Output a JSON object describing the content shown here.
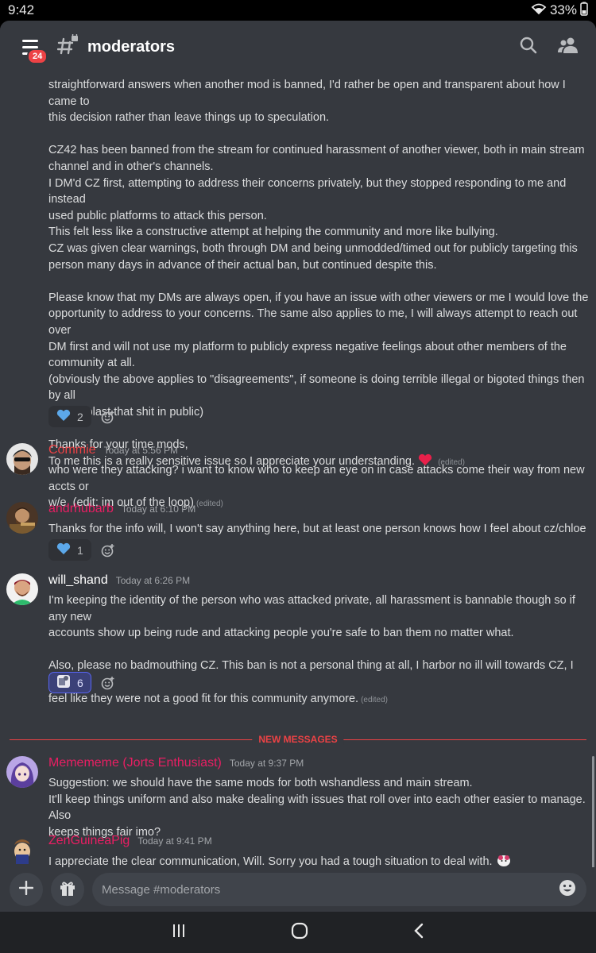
{
  "status": {
    "time": "9:42",
    "battery": "33%"
  },
  "header": {
    "channel": "moderators",
    "badge": "24"
  },
  "announcement": {
    "lines": [
      "straightforward answers when another mod is banned, I'd rather be open and transparent about how I came to",
      "this decision rather than leave things up to speculation.",
      "CZ42 has been banned from the stream for continued harassment of another viewer, both in main stream",
      "channel and in other's channels.",
      "I DM'd CZ first, attempting to address their concerns privately, but they stopped responding to me and instead",
      "used public platforms to attack this person.",
      "This felt less like a constructive attempt at helping the community and more like bullying.",
      "CZ was given clear warnings, both through DM and being unmodded/timed out for publicly targeting this",
      "person many days in advance of their actual ban, but continued despite this.",
      "Please know that my DMs are always open, if you have an issue with other viewers or me I would love the",
      "opportunity to address to your concerns. The same also applies to me, I will always attempt to reach out over",
      "DM first and will not use my platform to publicly express negative feelings about other members of the",
      "community at all.",
      "(obviously the above applies to \"disagreements\", if someone is doing terrible illegal or bigoted things then by all",
      "means blast that shit in public)",
      "Thanks for your time mods,",
      "To me this is a really sensitive issue so I appreciate your understanding."
    ],
    "edited": "(edited)",
    "reaction_count": "2"
  },
  "messages": [
    {
      "username": "Commie",
      "name_color": "#ed4245",
      "timestamp": "Today at 5:56 PM",
      "lines": [
        "who were they attacking? i want to know who to keep an eye on in case attacks come their way from new accts or",
        "w/e. (edit; im out of the loop)"
      ],
      "edited": "(edited)"
    },
    {
      "username": "andrhubarb",
      "name_color": "#e91e63",
      "timestamp": "Today at 6:10 PM",
      "lines": [
        "Thanks for the info will, I won't say anything here, but at least one person knows how I feel about cz/chloe"
      ],
      "reaction_count": "1"
    },
    {
      "username": "will_shand",
      "name_color": "#ffffff",
      "timestamp": "Today at 6:26 PM",
      "lines": [
        "I'm keeping the identity of the person who was attacked private, all harassment is bannable though so if any new",
        "accounts show up being rude and attacking people you're safe to ban them no matter what.",
        "Also, please no badmouthing CZ.  This ban is not a personal thing at all, I harbor no ill will towards CZ, I simply",
        "feel like they were not a good fit for this community anymore."
      ],
      "edited": "(edited)",
      "reaction_count": "6"
    },
    {
      "username": "Memememe (Jorts Enthusiast)",
      "name_color": "#e91e63",
      "timestamp": "Today at 9:37 PM",
      "lines": [
        "Suggestion: we should have the same mods for both wshandless and main stream.",
        "It'll keep things uniform and also make dealing with issues that roll over into each other easier to manage. Also",
        "keeps things fair imo?"
      ]
    },
    {
      "username": "ZenGuineaPig",
      "name_color": "#e91e63",
      "timestamp": "Today at 9:41 PM",
      "lines": [
        "I appreciate the clear communication, Will. Sorry you had a tough situation to deal with."
      ]
    }
  ],
  "divider": {
    "label": "NEW MESSAGES"
  },
  "composer": {
    "placeholder": "Message #moderators"
  },
  "colors": {
    "background": "#36393f",
    "accent": "#5865f2",
    "danger": "#ed4245",
    "heart": "#e8204a",
    "blue_heart": "#5ca8ea"
  }
}
